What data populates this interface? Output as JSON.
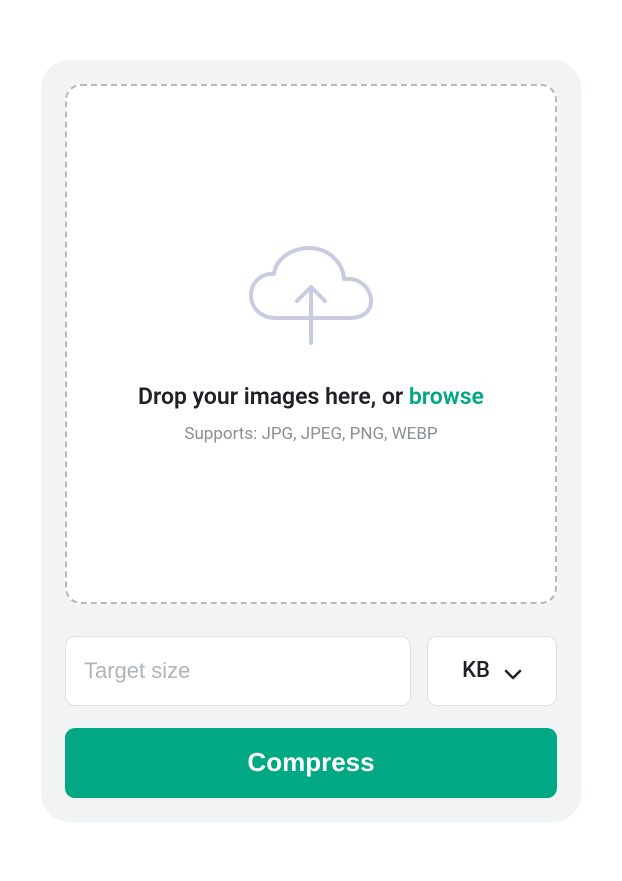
{
  "dropzone": {
    "main_text_prefix": "Drop your images here, or ",
    "browse_link": "browse",
    "supports_text": "Supports: JPG, JPEG, PNG, WEBP"
  },
  "controls": {
    "target_size_placeholder": "Target size",
    "target_size_value": "",
    "unit_selected": "KB"
  },
  "actions": {
    "compress_label": "Compress"
  },
  "colors": {
    "accent": "#00a884",
    "icon_stroke": "#c9cbe0"
  }
}
